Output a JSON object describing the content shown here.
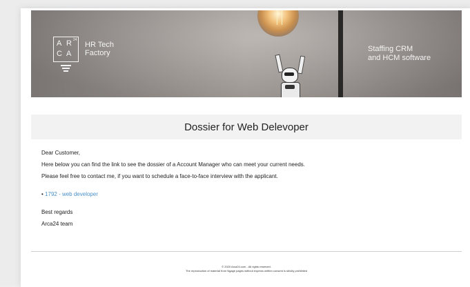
{
  "banner": {
    "logo": {
      "letters": [
        "A",
        "R",
        "C",
        "A"
      ],
      "superscript": "24",
      "line1": "HR Tech",
      "line2": "Factory"
    },
    "tagline_line1": "Staffing CRM",
    "tagline_line2": "and HCM software"
  },
  "title": "Dossier for Web Delevoper",
  "body": {
    "greeting": "Dear Customer,",
    "line1": "Here below you can find the link to see the dossier of a Account Manager who can meet your current needs.",
    "line2": "Please feel free to contact me, if you want to schedule a face-to-face interview with the applicant.",
    "bullet": "•",
    "link_text": "1792 - web developer",
    "closing": "Best regards",
    "signature": "Arca24 team"
  },
  "footer": {
    "copyright": "© 2020 Arca24.com - All rights reserved.",
    "notice": "The reproduction of material from Ngage pages without express written consent is strictly prohibited"
  },
  "colors": {
    "link": "#4a90c9",
    "title_bar": "#f2f2f2",
    "banner_base": "#a29c98"
  },
  "icons": [
    "arca24-logo",
    "light-bulb",
    "stormtrooper-figure"
  ]
}
